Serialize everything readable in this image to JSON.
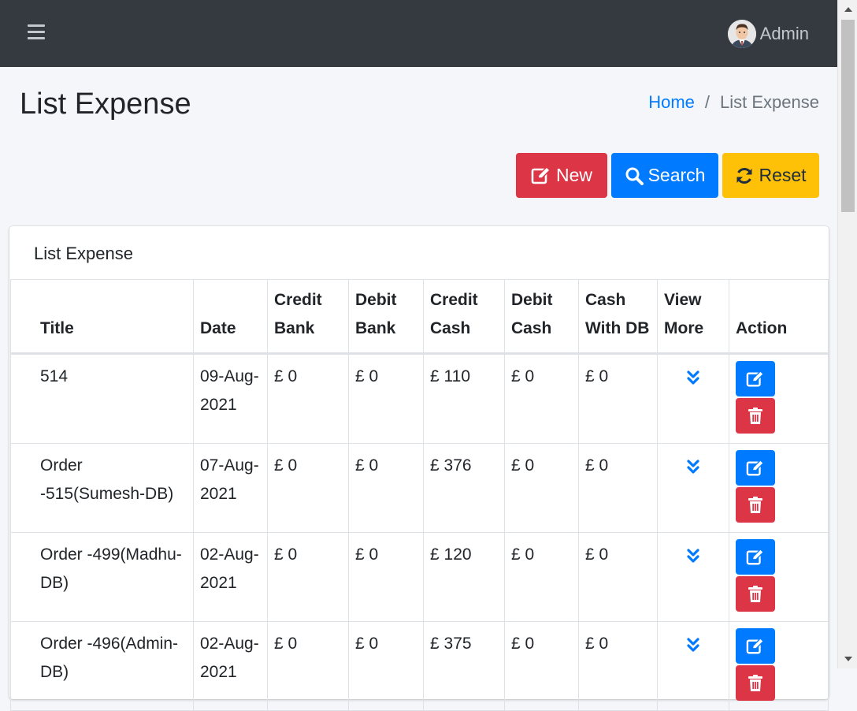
{
  "navbar": {
    "user_name": "Admin"
  },
  "page": {
    "title": "List Expense",
    "breadcrumb": {
      "home": "Home",
      "separator": "/",
      "current": "List Expense"
    }
  },
  "toolbar": {
    "new_label": "New",
    "search_label": "Search",
    "reset_label": "Reset"
  },
  "card": {
    "title": "List Expense"
  },
  "table": {
    "headers": [
      "Title",
      "Date",
      "Credit Bank",
      "Debit Bank",
      "Credit Cash",
      "Debit Cash",
      "Cash With DB",
      "View More",
      "Action"
    ],
    "rows": [
      {
        "title": "514",
        "date": "09-Aug-2021",
        "credit_bank": "£ 0",
        "debit_bank": "£ 0",
        "credit_cash": "£ 110",
        "debit_cash": "£ 0",
        "cash_with_db": "£ 0"
      },
      {
        "title": "Order -515(Sumesh-DB)",
        "date": "07-Aug-2021",
        "credit_bank": "£ 0",
        "debit_bank": "£ 0",
        "credit_cash": "£ 376",
        "debit_cash": "£ 0",
        "cash_with_db": "£ 0"
      },
      {
        "title": "Order -499(Madhu-DB)",
        "date": "02-Aug-2021",
        "credit_bank": "£ 0",
        "debit_bank": "£ 0",
        "credit_cash": "£ 120",
        "debit_cash": "£ 0",
        "cash_with_db": "£ 0"
      },
      {
        "title": "Order -496(Admin-DB)",
        "date": "02-Aug-2021",
        "credit_bank": "£ 0",
        "debit_bank": "£ 0",
        "credit_cash": "£ 375",
        "debit_cash": "£ 0",
        "cash_with_db": "£ 0"
      }
    ]
  },
  "colors": {
    "navbar": "#343a40",
    "primary": "#007bff",
    "danger": "#dc3545",
    "warning": "#ffc107"
  },
  "icons": {
    "menu": "hamburger-icon",
    "new": "edit-icon",
    "search": "search-icon",
    "reset": "sync-icon",
    "view_more": "angle-double-down-icon",
    "edit": "edit-icon",
    "delete": "trash-icon"
  }
}
